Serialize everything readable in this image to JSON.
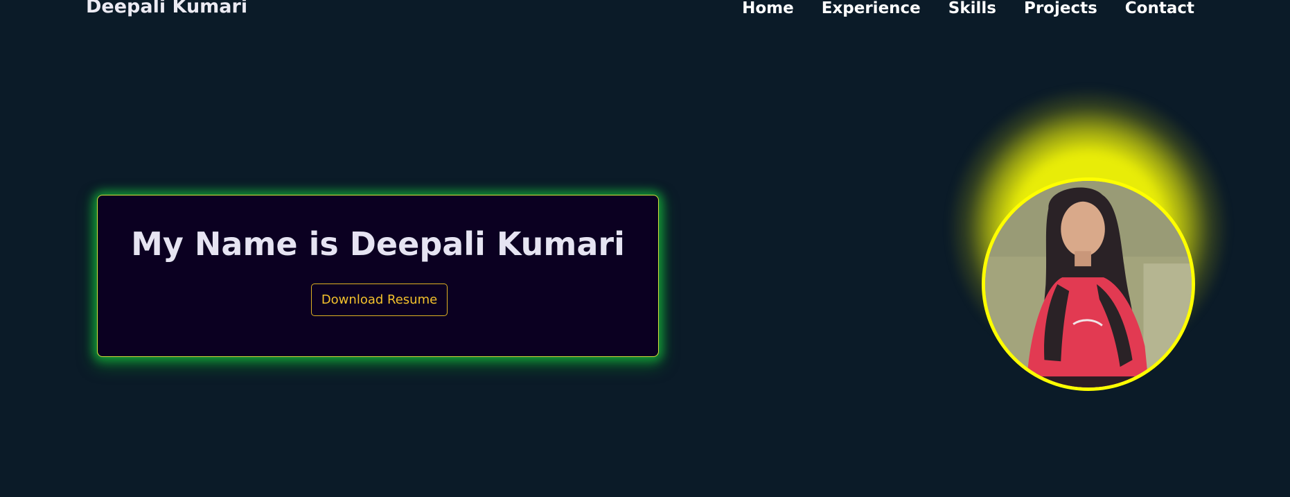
{
  "header": {
    "brand": "Deepali Kumari",
    "nav": [
      {
        "label": "Home"
      },
      {
        "label": "Experience"
      },
      {
        "label": "Skills"
      },
      {
        "label": "Projects"
      },
      {
        "label": "Contact"
      }
    ]
  },
  "hero": {
    "title": "My Name is Deepali Kumari",
    "resume_button": "Download Resume",
    "portrait": "profile-photo"
  },
  "colors": {
    "background": "#0b1b28",
    "card_background": "#0b0021",
    "card_border": "#d6e23a",
    "card_glow": "#16b23c",
    "button_accent": "#f3c12c",
    "photo_ring": "#ffff00",
    "photo_glow": "#e8ec08"
  }
}
